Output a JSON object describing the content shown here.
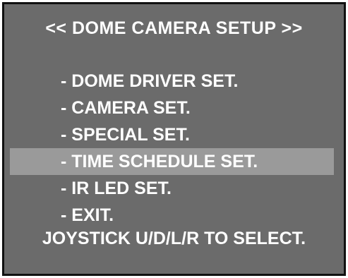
{
  "screen": {
    "title": "<< DOME CAMERA SETUP >>",
    "menu": [
      {
        "label": "- DOME DRIVER SET."
      },
      {
        "label": "- CAMERA SET."
      },
      {
        "label": "- SPECIAL SET."
      },
      {
        "label": "- TIME SCHEDULE SET.",
        "selected": true
      },
      {
        "label": "- IR LED SET."
      },
      {
        "label": "- EXIT."
      }
    ],
    "footer": "JOYSTICK U/D/L/R TO SELECT.",
    "colors": {
      "background": "#6b6b6b",
      "highlight": "#9a9a9a",
      "text": "#ffffff",
      "border": "#111111"
    }
  }
}
